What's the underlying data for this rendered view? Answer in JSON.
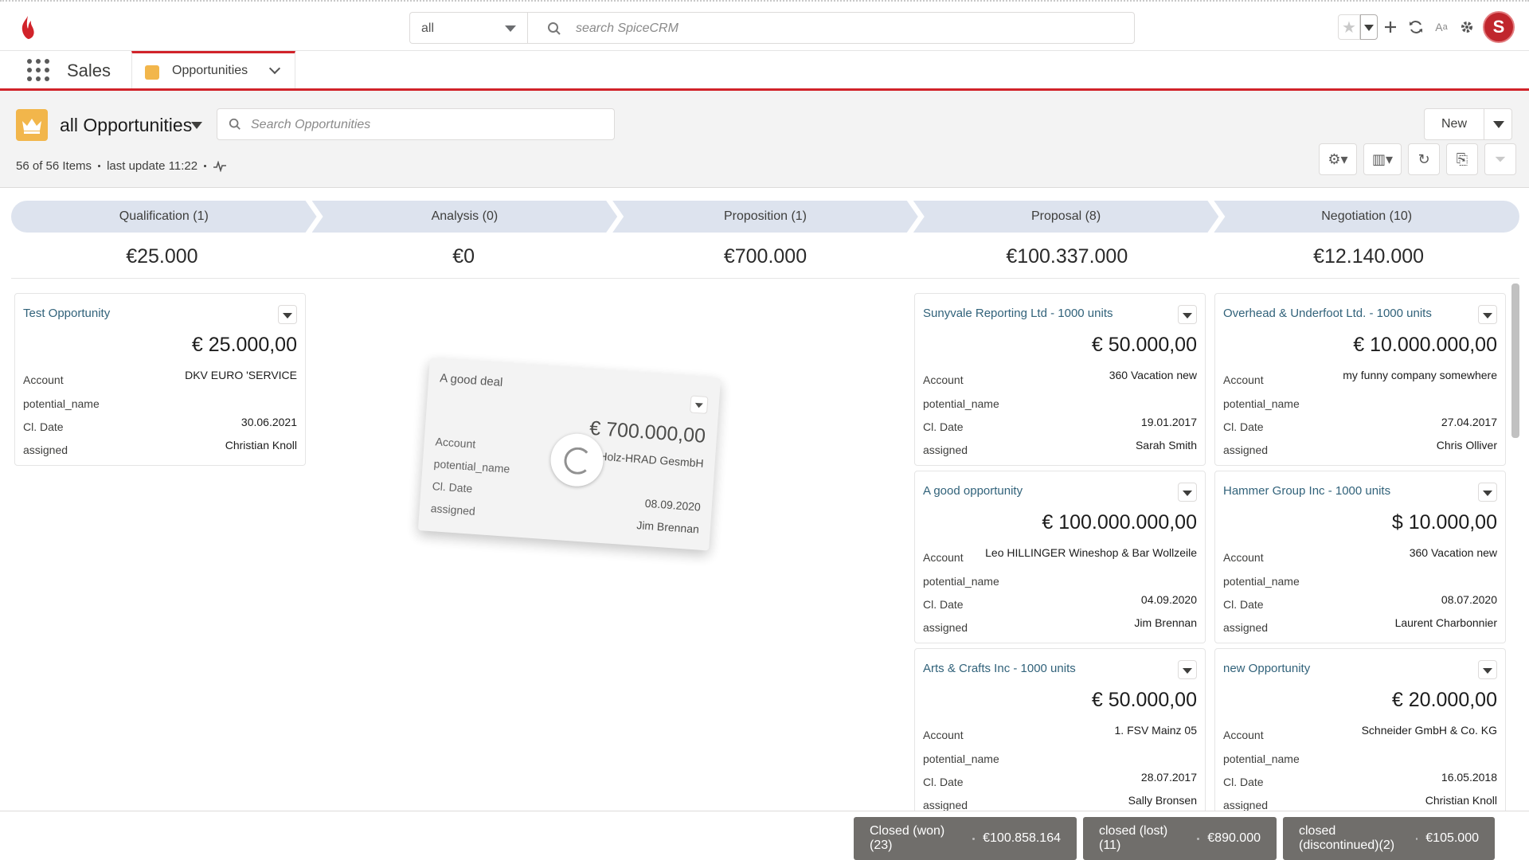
{
  "header": {
    "scope_value": "all",
    "search_placeholder": "search SpiceCRM",
    "icons": [
      "star-icon",
      "chevron-down-icon",
      "plus-icon",
      "refresh-icon",
      "font-size-icon",
      "gear-icon",
      "avatar"
    ]
  },
  "appnav": {
    "app_name": "Sales",
    "tab_label": "Opportunities"
  },
  "list": {
    "title": "all Opportunities",
    "search_placeholder": "Search Opportunities",
    "items_count": "56 of 56 Items",
    "last_update": "last update 11:22",
    "new_label": "New"
  },
  "stages": [
    {
      "label": "Qualification (1)",
      "total": "€25.000"
    },
    {
      "label": "Analysis (0)",
      "total": "€0"
    },
    {
      "label": "Proposition (1)",
      "total": "€700.000"
    },
    {
      "label": "Proposal (8)",
      "total": "€100.337.000"
    },
    {
      "label": "Negotiation (10)",
      "total": "€12.140.000"
    }
  ],
  "field_labels": {
    "account": "Account",
    "potential": "potential_name",
    "close_date": "Cl. Date",
    "assigned": "assigned"
  },
  "columns": {
    "qualification": [
      {
        "name": "Test Opportunity",
        "amount": "€ 25.000,00",
        "account": "DKV EURO 'SERVICE",
        "close_date": "30.06.2021",
        "assigned": "Christian Knoll"
      }
    ],
    "proposal": [
      {
        "name": "Sunyvale Reporting Ltd - 1000 units",
        "amount": "€ 50.000,00",
        "account": "360 Vacation new",
        "close_date": "19.01.2017",
        "assigned": "Sarah Smith"
      },
      {
        "name": "A good opportunity",
        "amount": "€ 100.000.000,00",
        "account": "Leo HILLINGER Wineshop & Bar Wollzeile",
        "close_date": "04.09.2020",
        "assigned": "Jim Brennan"
      },
      {
        "name": "Arts & Crafts Inc - 1000 units",
        "amount": "€ 50.000,00",
        "account": "1. FSV Mainz 05",
        "close_date": "28.07.2017",
        "assigned": "Sally Bronsen"
      }
    ],
    "negotiation": [
      {
        "name": "Overhead & Underfoot Ltd. - 1000 units",
        "amount": "€ 10.000.000,00",
        "account": "my funny company somewhere",
        "close_date": "27.04.2017",
        "assigned": "Chris Olliver"
      },
      {
        "name": "Hammer Group Inc - 1000 units",
        "amount": "$ 10.000,00",
        "account": "360 Vacation new",
        "close_date": "08.07.2020",
        "assigned": "Laurent Charbonnier"
      },
      {
        "name": "new Opportunity",
        "amount": "€ 20.000,00",
        "account": "Schneider GmbH & Co. KG",
        "close_date": "16.05.2018",
        "assigned": "Christian Knoll"
      }
    ]
  },
  "dragged": {
    "name": "A good deal",
    "amount": "€ 700.000,00",
    "account": "Holz-HRAD GesmbH",
    "close_date": "08.09.2020",
    "assigned": "Jim Brennan"
  },
  "footer": [
    {
      "label": "Closed (won)(23)",
      "amount": "€100.858.164"
    },
    {
      "label": "closed (lost)(11)",
      "amount": "€890.000"
    },
    {
      "label": "closed (discontinued)(2)",
      "amount": "€105.000"
    }
  ]
}
